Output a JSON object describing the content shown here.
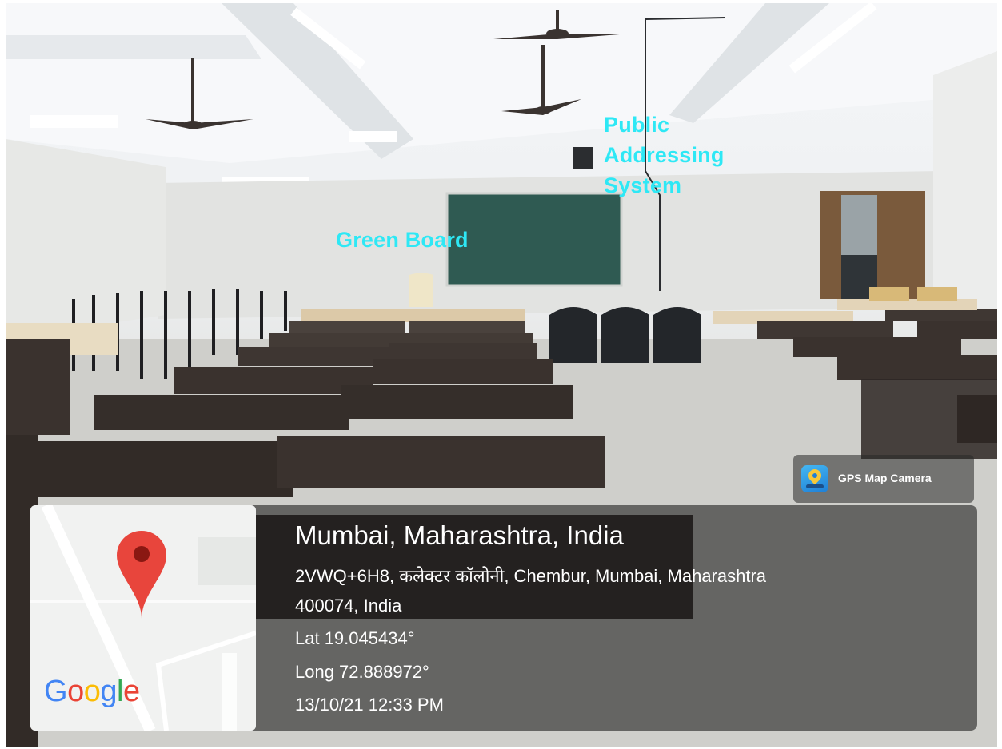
{
  "annotations": {
    "green_board": "Green Board",
    "public_addressing": [
      "Public",
      "Addressing",
      "System"
    ]
  },
  "gps_badge": {
    "app_name": "GPS Map Camera",
    "icon": "gps-map-camera-icon"
  },
  "location": {
    "title": "Mumbai, Maharashtra, India",
    "address_line1": "2VWQ+6H8, कलेक्टर कॉलोनी, Chembur, Mumbai, Maharashtra",
    "address_line2": "400074, India",
    "latitude": "Lat 19.045434°",
    "longitude": "Long 72.888972°",
    "datetime": "13/10/21 12:33 PM"
  },
  "map": {
    "logo": "Google",
    "pin_icon": "map-pin-icon"
  },
  "colors": {
    "annotation": "#2ee8f5",
    "pin": "#e8453c",
    "google_blue": "#4285f4",
    "google_red": "#ea4335",
    "google_yellow": "#fbbc05",
    "google_green": "#34a853"
  }
}
